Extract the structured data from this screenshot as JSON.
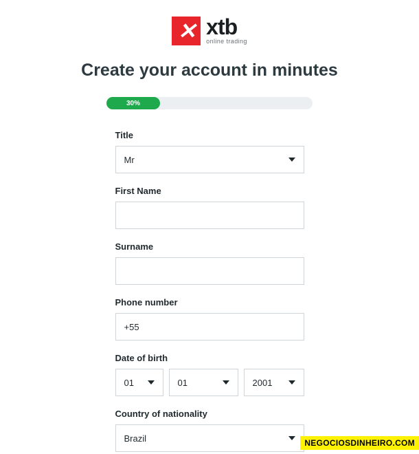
{
  "logo": {
    "glyph": "✕",
    "brand": "xtb",
    "tagline": "online trading"
  },
  "heading": "Create your account in minutes",
  "progress": {
    "percent_label": "30%"
  },
  "form": {
    "title": {
      "label": "Title",
      "value": "Mr"
    },
    "first_name": {
      "label": "First Name",
      "value": ""
    },
    "surname": {
      "label": "Surname",
      "value": ""
    },
    "phone": {
      "label": "Phone number",
      "value": "+55"
    },
    "dob": {
      "label": "Date of birth",
      "day": "01",
      "month": "01",
      "year": "2001"
    },
    "nationality": {
      "label": "Country of nationality",
      "value": "Brazil"
    }
  },
  "watermark": "NEGOCIOSDINHEIRO.COM"
}
